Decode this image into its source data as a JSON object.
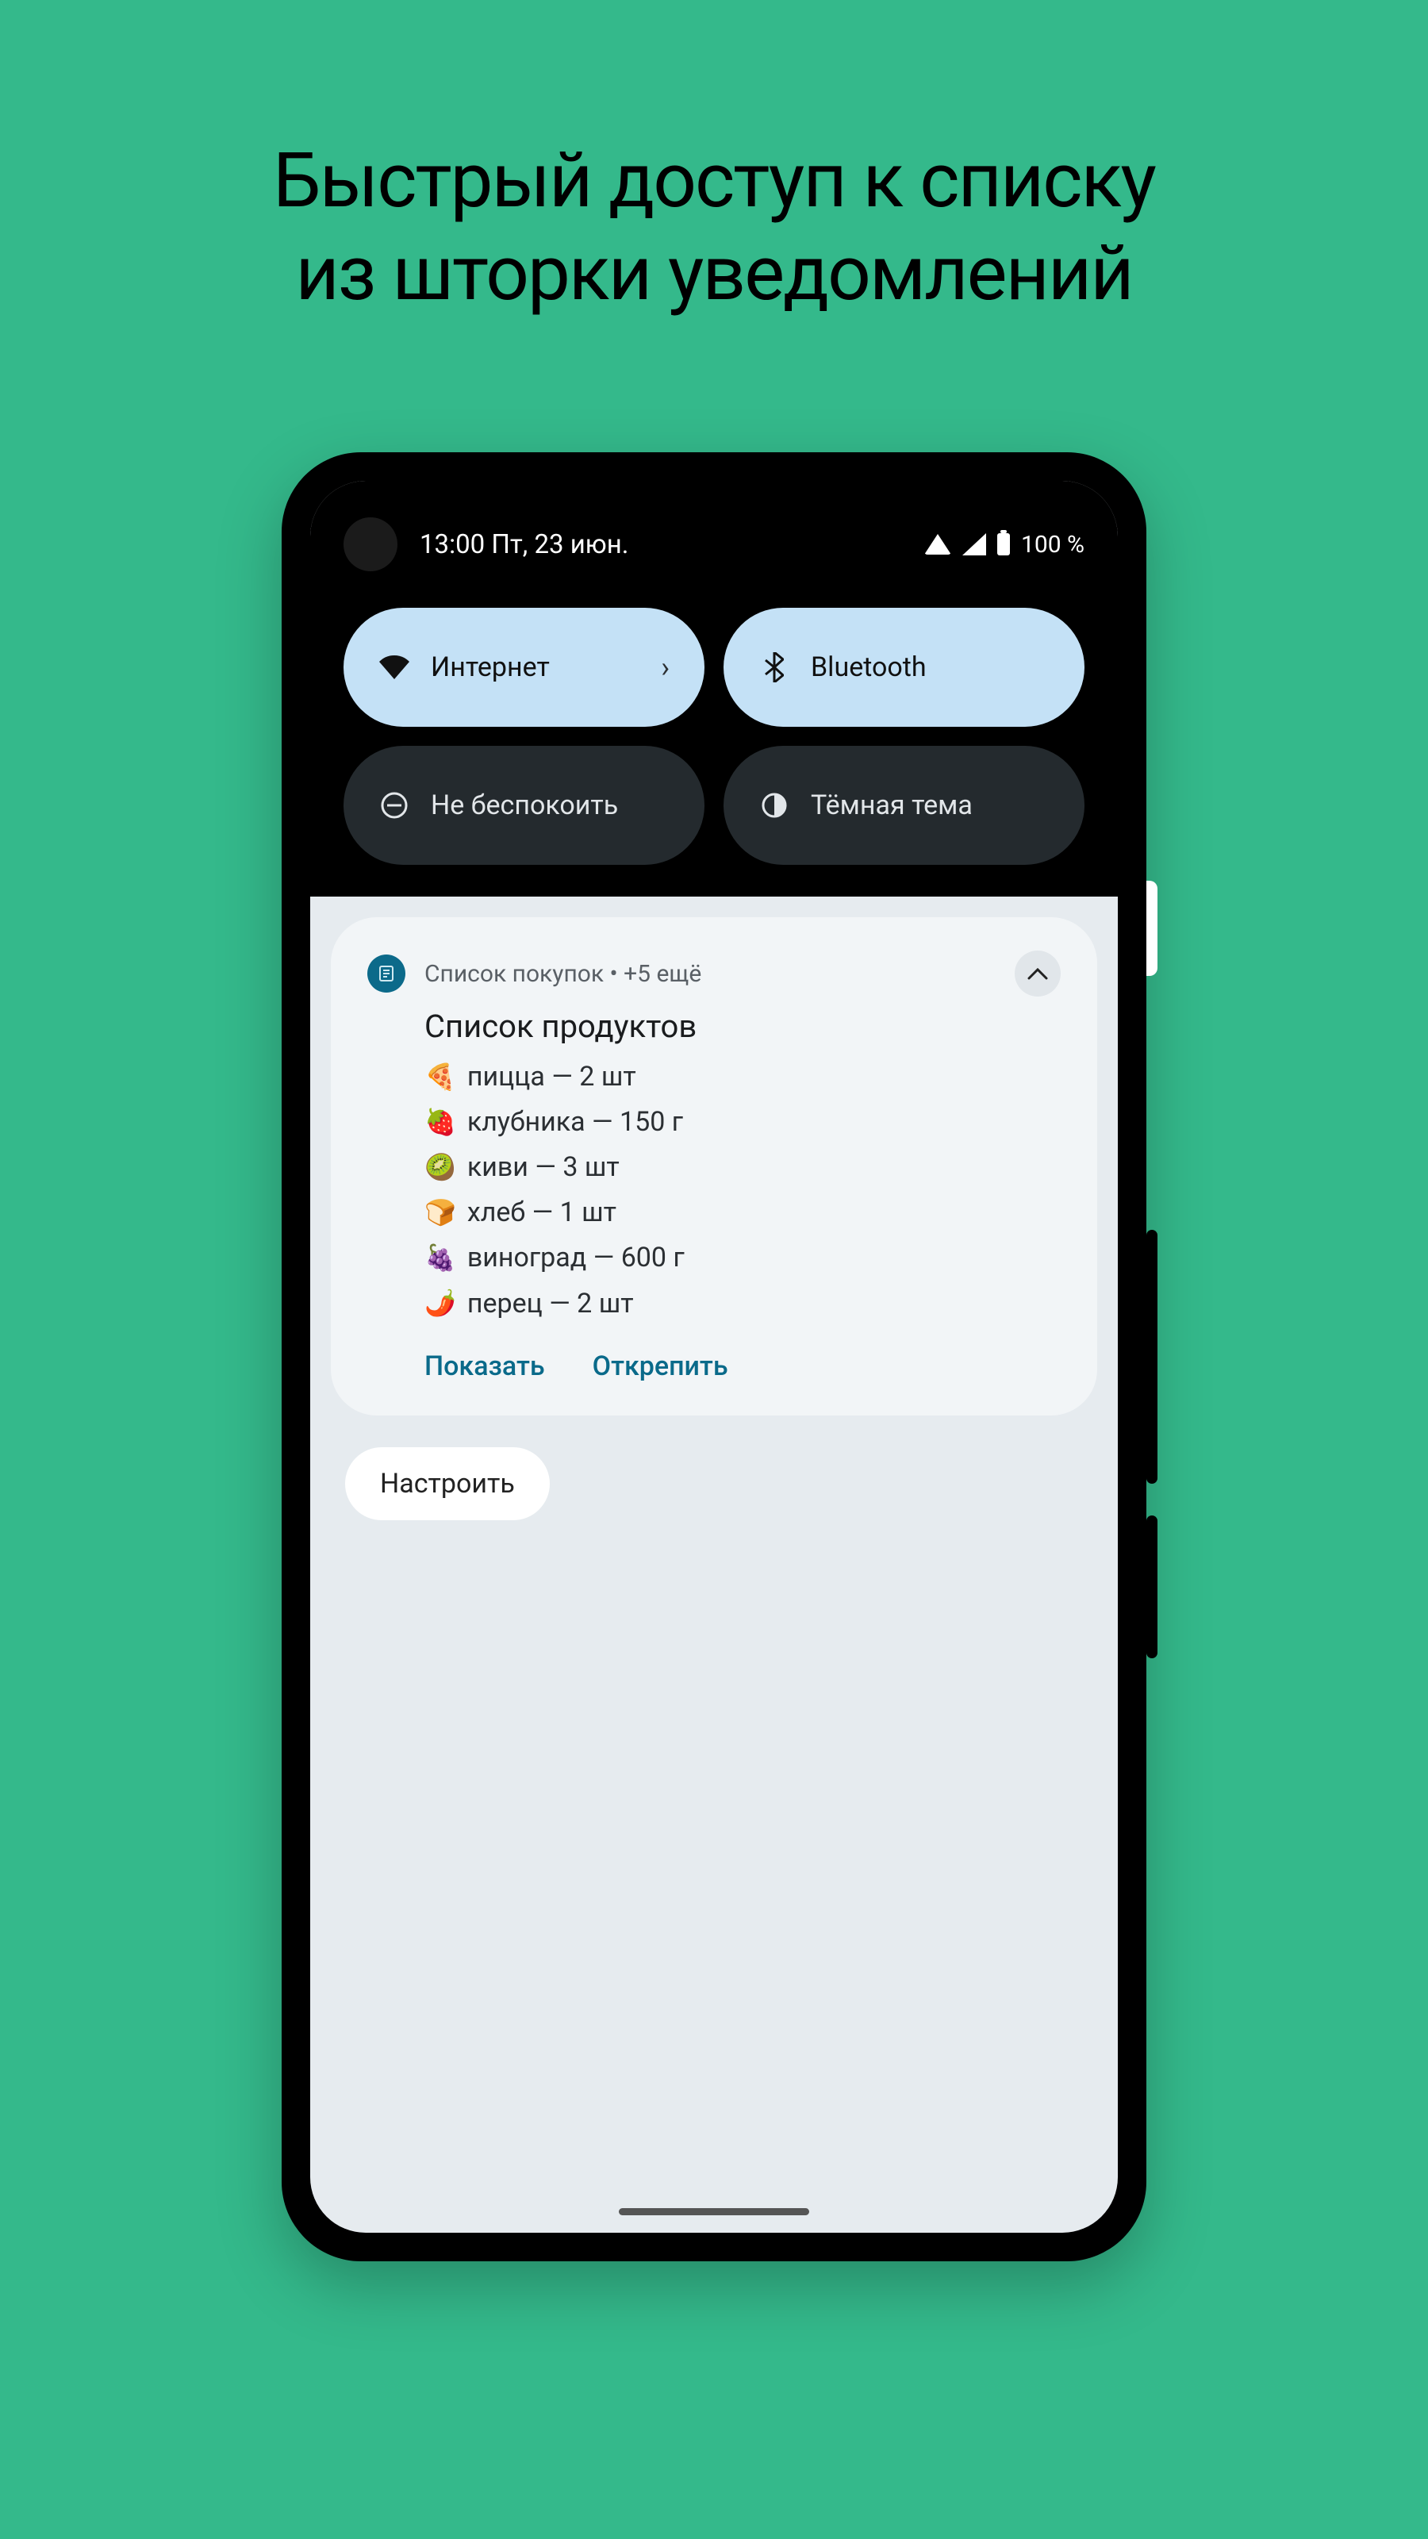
{
  "hero": {
    "line1": "Быстрый доступ к списку",
    "line2": "из шторки уведомлений"
  },
  "status": {
    "time_date": "13:00 Пт, 23 июн.",
    "battery_text": "100 %"
  },
  "qs": {
    "internet": {
      "label": "Интернет",
      "active": true
    },
    "bluetooth": {
      "label": "Bluetooth",
      "active": true
    },
    "dnd": {
      "label": "Не беспокоить",
      "active": false
    },
    "dark": {
      "label": "Тёмная тема",
      "active": false
    }
  },
  "notification": {
    "app_name": "Список покупок",
    "meta_suffix": " • +5 ещё",
    "title": "Список продуктов",
    "items": [
      {
        "emoji": "🍕",
        "text": "пицца — 2 шт"
      },
      {
        "emoji": "🍓",
        "text": "клубника  — 150 г"
      },
      {
        "emoji": "🥝",
        "text": "киви  — 3 шт"
      },
      {
        "emoji": "🍞",
        "text": "хлеб  — 1 шт"
      },
      {
        "emoji": "🍇",
        "text": "виноград  — 600 г"
      },
      {
        "emoji": "🌶️",
        "text": "перец — 2 шт"
      }
    ],
    "actions": {
      "show": "Показать",
      "unpin": "Открепить"
    }
  },
  "configure_label": "Настроить"
}
